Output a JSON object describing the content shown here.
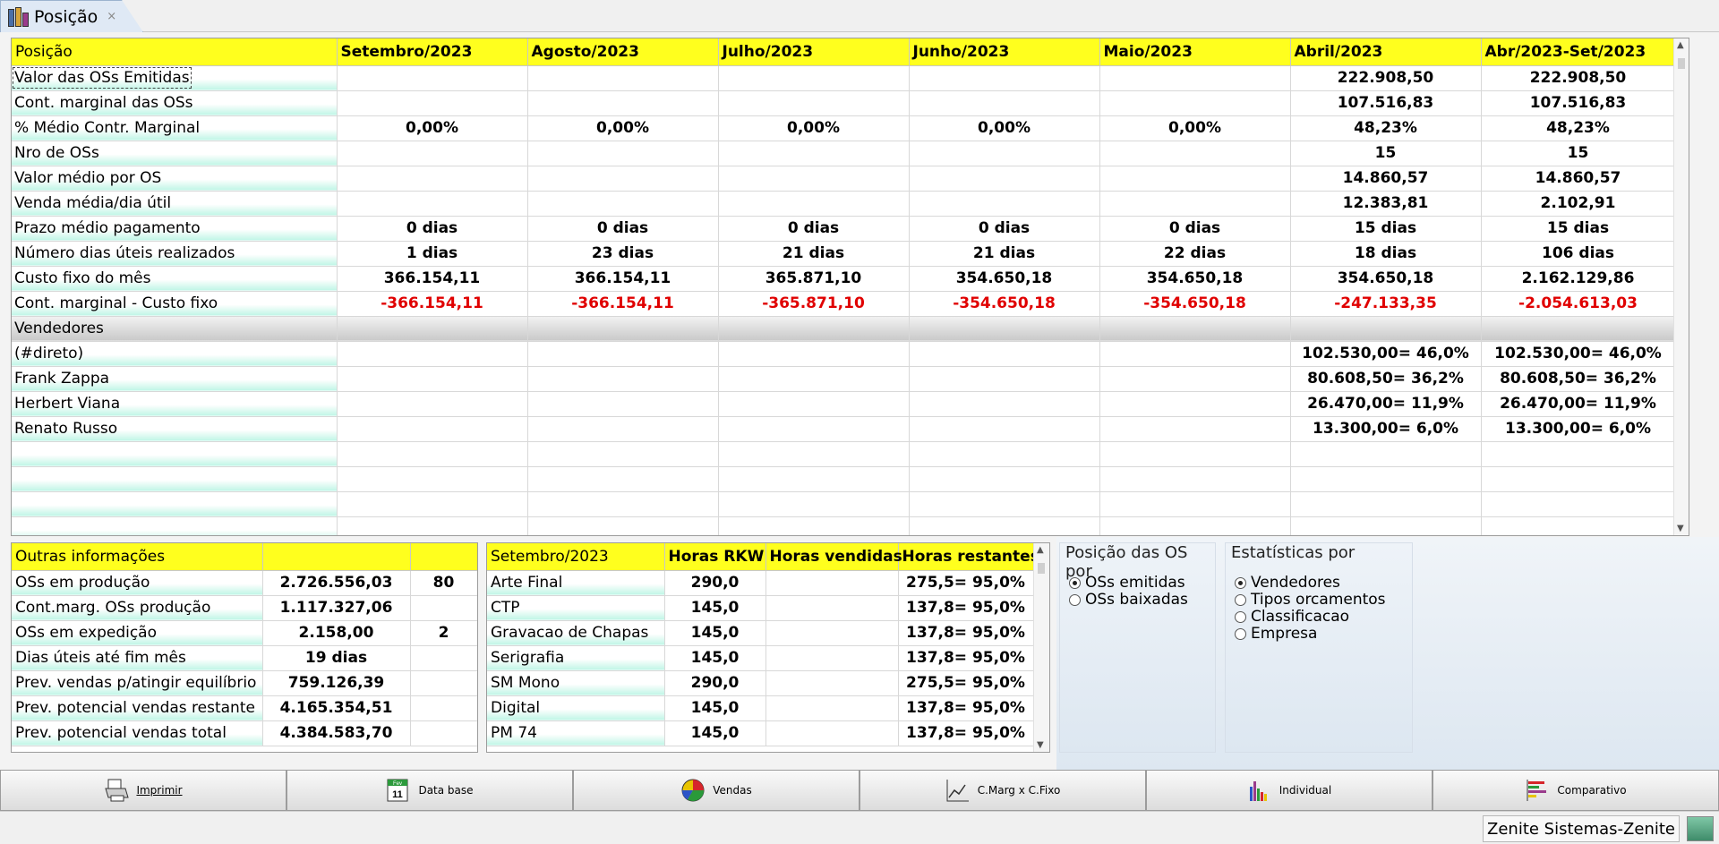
{
  "tab": {
    "title": "Posição",
    "close": "×"
  },
  "main": {
    "headers": [
      "Posição",
      "Setembro/2023",
      "Agosto/2023",
      "Julho/2023",
      "Junho/2023",
      "Maio/2023",
      "Abril/2023",
      "Abr/2023-Set/2023"
    ],
    "rows": [
      {
        "label": "Valor das OSs Emitidas",
        "cells": [
          "",
          "",
          "",
          "",
          "",
          "222.908,50",
          "222.908,50"
        ]
      },
      {
        "label": "Cont. marginal das OSs",
        "cells": [
          "",
          "",
          "",
          "",
          "",
          "107.516,83",
          "107.516,83"
        ]
      },
      {
        "label": "% Médio Contr. Marginal",
        "cells": [
          "0,00%",
          "0,00%",
          "0,00%",
          "0,00%",
          "0,00%",
          "48,23%",
          "48,23%"
        ]
      },
      {
        "label": "Nro de OSs",
        "cells": [
          "",
          "",
          "",
          "",
          "",
          "15",
          "15"
        ]
      },
      {
        "label": "Valor médio por OS",
        "cells": [
          "",
          "",
          "",
          "",
          "",
          "14.860,57",
          "14.860,57"
        ]
      },
      {
        "label": "Venda média/dia útil",
        "cells": [
          "",
          "",
          "",
          "",
          "",
          "12.383,81",
          "2.102,91"
        ]
      },
      {
        "label": "Prazo médio pagamento",
        "cells": [
          "0 dias",
          "0 dias",
          "0 dias",
          "0 dias",
          "0 dias",
          "15 dias",
          "15 dias"
        ]
      },
      {
        "label": "Número dias úteis realizados",
        "cells": [
          "1 dias",
          "23 dias",
          "21 dias",
          "21 dias",
          "22 dias",
          "18 dias",
          "106 dias"
        ]
      },
      {
        "label": "Custo fixo do mês",
        "cells": [
          "366.154,11",
          "366.154,11",
          "365.871,10",
          "354.650,18",
          "354.650,18",
          "354.650,18",
          "2.162.129,86"
        ]
      },
      {
        "label": "Cont. marginal - Custo fixo",
        "cells": [
          "-366.154,11",
          "-366.154,11",
          "-365.871,10",
          "-354.650,18",
          "-354.650,18",
          "-247.133,35",
          "-2.054.613,03"
        ]
      },
      {
        "label": "Vendedores",
        "cells": [
          "",
          "",
          "",
          "",
          "",
          "",
          ""
        ]
      },
      {
        "label": "(#direto)",
        "cells": [
          "",
          "",
          "",
          "",
          "",
          "102.530,00= 46,0%",
          "102.530,00= 46,0%"
        ]
      },
      {
        "label": "Frank Zappa",
        "cells": [
          "",
          "",
          "",
          "",
          "",
          "80.608,50= 36,2%",
          "80.608,50= 36,2%"
        ]
      },
      {
        "label": "Herbert Viana",
        "cells": [
          "",
          "",
          "",
          "",
          "",
          "26.470,00= 11,9%",
          "26.470,00= 11,9%"
        ]
      },
      {
        "label": "Renato Russo",
        "cells": [
          "",
          "",
          "",
          "",
          "",
          "13.300,00=  6,0%",
          "13.300,00=  6,0%"
        ]
      },
      {
        "label": "",
        "cells": [
          "",
          "",
          "",
          "",
          "",
          "",
          ""
        ]
      },
      {
        "label": "",
        "cells": [
          "",
          "",
          "",
          "",
          "",
          "",
          ""
        ]
      },
      {
        "label": "",
        "cells": [
          "",
          "",
          "",
          "",
          "",
          "",
          ""
        ]
      },
      {
        "label": "",
        "cells": [
          "",
          "",
          "",
          "",
          "",
          "",
          ""
        ]
      }
    ]
  },
  "outras": {
    "headers": [
      "Outras informações",
      "",
      ""
    ],
    "rows": [
      {
        "label": "OSs em produção",
        "value": "2.726.556,03",
        "count": "80"
      },
      {
        "label": "Cont.marg. OSs produção",
        "value": "1.117.327,06",
        "count": ""
      },
      {
        "label": "OSs em expedição",
        "value": "2.158,00",
        "count": "2"
      },
      {
        "label": "Dias úteis até fim mês",
        "value": "19 dias",
        "count": ""
      },
      {
        "label": "Prev. vendas p/atingir equilíbrio",
        "value": "759.126,39",
        "count": ""
      },
      {
        "label": "Prev. potencial vendas restante",
        "value": "4.165.354,51",
        "count": ""
      },
      {
        "label": "Prev. potencial vendas total",
        "value": "4.384.583,70",
        "count": ""
      }
    ]
  },
  "horas": {
    "headers": [
      "Setembro/2023",
      "Horas RKW",
      "Horas vendidas",
      "Horas restantes"
    ],
    "rows": [
      {
        "label": "Arte Final",
        "rkw": "290,0",
        "vendidas": "",
        "restantes": "275,5= 95,0%"
      },
      {
        "label": "CTP",
        "rkw": "145,0",
        "vendidas": "",
        "restantes": "137,8= 95,0%"
      },
      {
        "label": "Gravacao de Chapas",
        "rkw": "145,0",
        "vendidas": "",
        "restantes": "137,8= 95,0%"
      },
      {
        "label": "Serigrafia",
        "rkw": "145,0",
        "vendidas": "",
        "restantes": "137,8= 95,0%"
      },
      {
        "label": "SM Mono",
        "rkw": "290,0",
        "vendidas": "",
        "restantes": "275,5= 95,0%"
      },
      {
        "label": "Digital",
        "rkw": "145,0",
        "vendidas": "",
        "restantes": "137,8= 95,0%"
      },
      {
        "label": "PM 74",
        "rkw": "145,0",
        "vendidas": "",
        "restantes": "137,8= 95,0%"
      }
    ]
  },
  "posicao_os": {
    "title": "Posição das OS por",
    "options": [
      {
        "label": "OSs emitidas",
        "selected": true
      },
      {
        "label": "OSs baixadas",
        "selected": false
      }
    ]
  },
  "estatisticas": {
    "title": "Estatísticas por",
    "options": [
      {
        "label": "Vendedores",
        "selected": true
      },
      {
        "label": "Tipos orcamentos",
        "selected": false
      },
      {
        "label": "Classificacao",
        "selected": false
      },
      {
        "label": "Empresa",
        "selected": false
      }
    ]
  },
  "buttons": [
    {
      "label": "Imprimir",
      "icon": "printer-icon"
    },
    {
      "label": "Data base",
      "icon": "calendar-icon",
      "calendar_month": "Fev",
      "calendar_day": "11"
    },
    {
      "label": "Vendas",
      "icon": "pie-chart-icon"
    },
    {
      "label": "C.Marg x C.Fixo",
      "icon": "line-chart-icon"
    },
    {
      "label": "Individual",
      "icon": "bar-chart-icon"
    },
    {
      "label": "Comparativo",
      "icon": "horizontal-bar-chart-icon"
    }
  ],
  "status": {
    "text": "Zenite Sistemas-Zenite"
  },
  "colors": {
    "header_yellow": "#ffff1e",
    "row_mint": "#bff5e6",
    "negative": "#e00000"
  }
}
